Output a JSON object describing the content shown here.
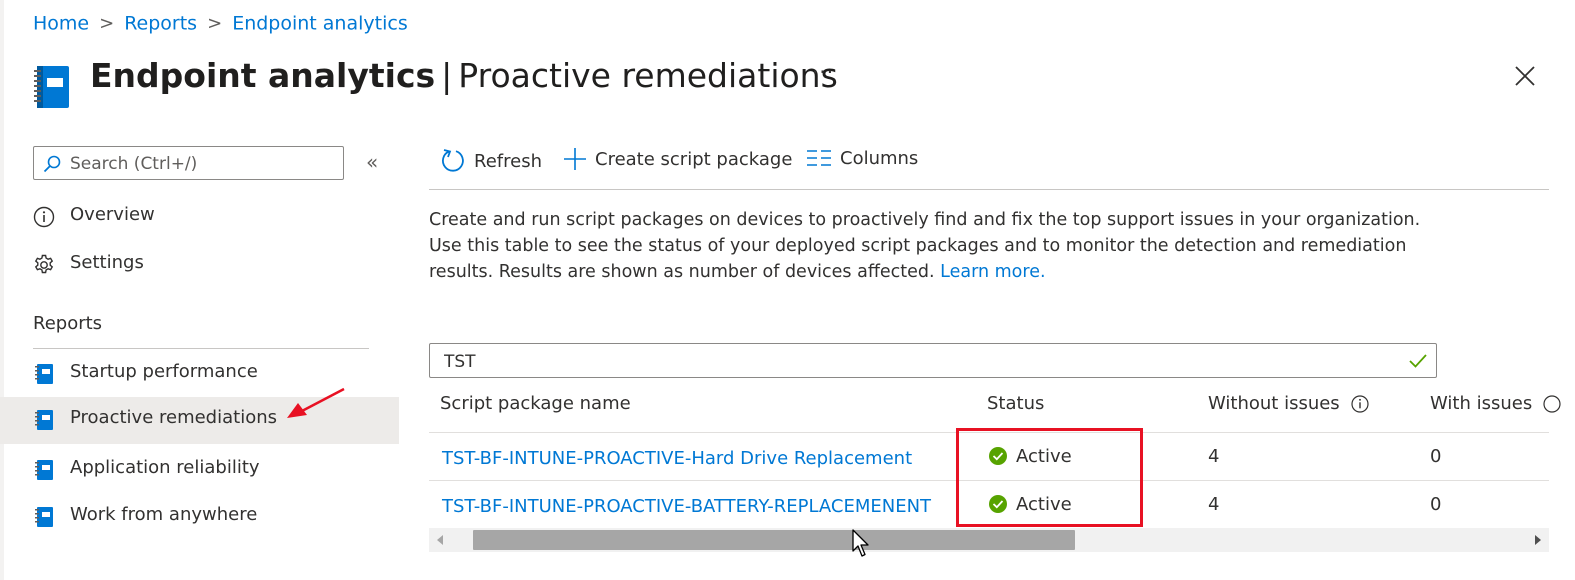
{
  "breadcrumb": {
    "home": "Home",
    "reports": "Reports",
    "current": "Endpoint analytics",
    "separator": ">"
  },
  "header": {
    "title": "Endpoint analytics",
    "separator": "|",
    "subtitle": "Proactive remediations",
    "more": "···"
  },
  "sidebar": {
    "search_placeholder": "Search (Ctrl+/)",
    "collapse": "«",
    "items": [
      {
        "label": "Overview",
        "icon": "info-icon"
      },
      {
        "label": "Settings",
        "icon": "gear-icon"
      }
    ],
    "reports_heading": "Reports",
    "report_items": [
      {
        "label": "Startup performance",
        "icon": "notebook-icon"
      },
      {
        "label": "Proactive remediations",
        "icon": "notebook-icon",
        "selected": true
      },
      {
        "label": "Application reliability",
        "icon": "notebook-icon"
      },
      {
        "label": "Work from anywhere",
        "icon": "notebook-icon"
      }
    ]
  },
  "toolbar": {
    "refresh": "Refresh",
    "create": "Create script package",
    "columns": "Columns"
  },
  "description": {
    "text": "Create and run script packages on devices to proactively find and fix the top support issues in your organization. Use this table to see the status of your deployed script packages and to monitor the detection and remediation results. Results are shown as number of devices affected.",
    "link": "Learn more."
  },
  "filter": {
    "value": "TST"
  },
  "table": {
    "columns": [
      "Script package name",
      "Status",
      "Without issues",
      "With issues"
    ],
    "rows": [
      {
        "name": "TST-BF-INTUNE-PROACTIVE-Hard Drive Replacement",
        "status": "Active",
        "without": "4",
        "with": "0"
      },
      {
        "name": "TST-BF-INTUNE-PROACTIVE-BATTERY-REPLACEMENENT",
        "status": "Active",
        "without": "4",
        "with": "0"
      }
    ]
  },
  "colors": {
    "accent": "#0078d4",
    "success": "#57a300",
    "annotation": "#e81123",
    "selected_bg": "#edebe9"
  },
  "scrollbar": {
    "thumb_start_fraction": 0.02,
    "thumb_size_fraction": 0.56
  }
}
